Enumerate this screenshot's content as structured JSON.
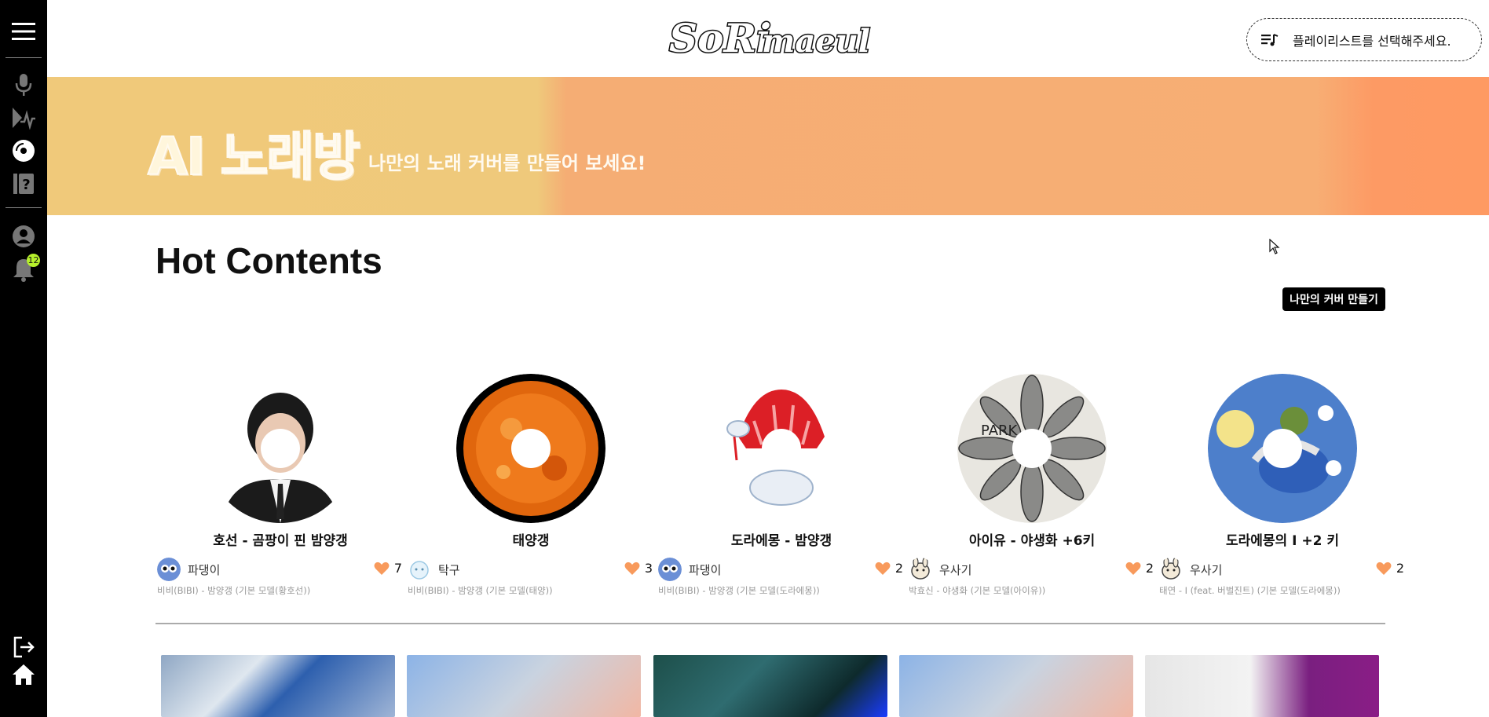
{
  "app": {
    "logo_text": "SoRimaeul"
  },
  "header": {
    "playlist_placeholder": "플레이리스트를 선택해주세요."
  },
  "sidebar": {
    "items": [
      {
        "icon": "menu-icon"
      },
      {
        "icon": "microphone-icon"
      },
      {
        "icon": "voice-wave-icon"
      },
      {
        "icon": "disc-icon"
      },
      {
        "icon": "help-book-icon"
      },
      {
        "icon": "user-icon"
      },
      {
        "icon": "bell-icon",
        "badge": "12"
      },
      {
        "icon": "logout-icon"
      },
      {
        "icon": "home-icon"
      }
    ]
  },
  "banner": {
    "title": "AI 노래방",
    "subtitle": "나만의 노래 커버를 만들어 보세요!"
  },
  "section": {
    "title": "Hot Contents",
    "cover_button": "나만의 커버 만들기"
  },
  "cards": [
    {
      "title": "호선 - 곰팡이 핀 밤양갱",
      "user": "파댕이",
      "likes": "7",
      "meta": "비비(BIBI) - 밤양갱 (기본 모델(황호선))"
    },
    {
      "title": "태양갱",
      "user": "탁구",
      "likes": "3",
      "meta": "비비(BIBI) - 밤양갱 (기본 모델(태양))"
    },
    {
      "title": "도라에몽 - 밤양갱",
      "user": "파댕이",
      "likes": "2",
      "meta": "비비(BIBI) - 밤양갱 (기본 모델(도라에몽))"
    },
    {
      "title": "아이유 - 야생화 +6키",
      "user": "우사기",
      "likes": "2",
      "meta": "박효신 - 야생화 (기본 모델(아이유))"
    },
    {
      "title": "도라에몽의 I +2 키",
      "user": "우사기",
      "likes": "2",
      "meta": "태연 - I (feat. 버벌진트) (기본 모델(도라에몽))"
    }
  ],
  "colors": {
    "banner_left": "#f0c97a",
    "banner_right": "#f7ae74",
    "heart": "#f89a5c",
    "badge": "#b6f02c"
  }
}
